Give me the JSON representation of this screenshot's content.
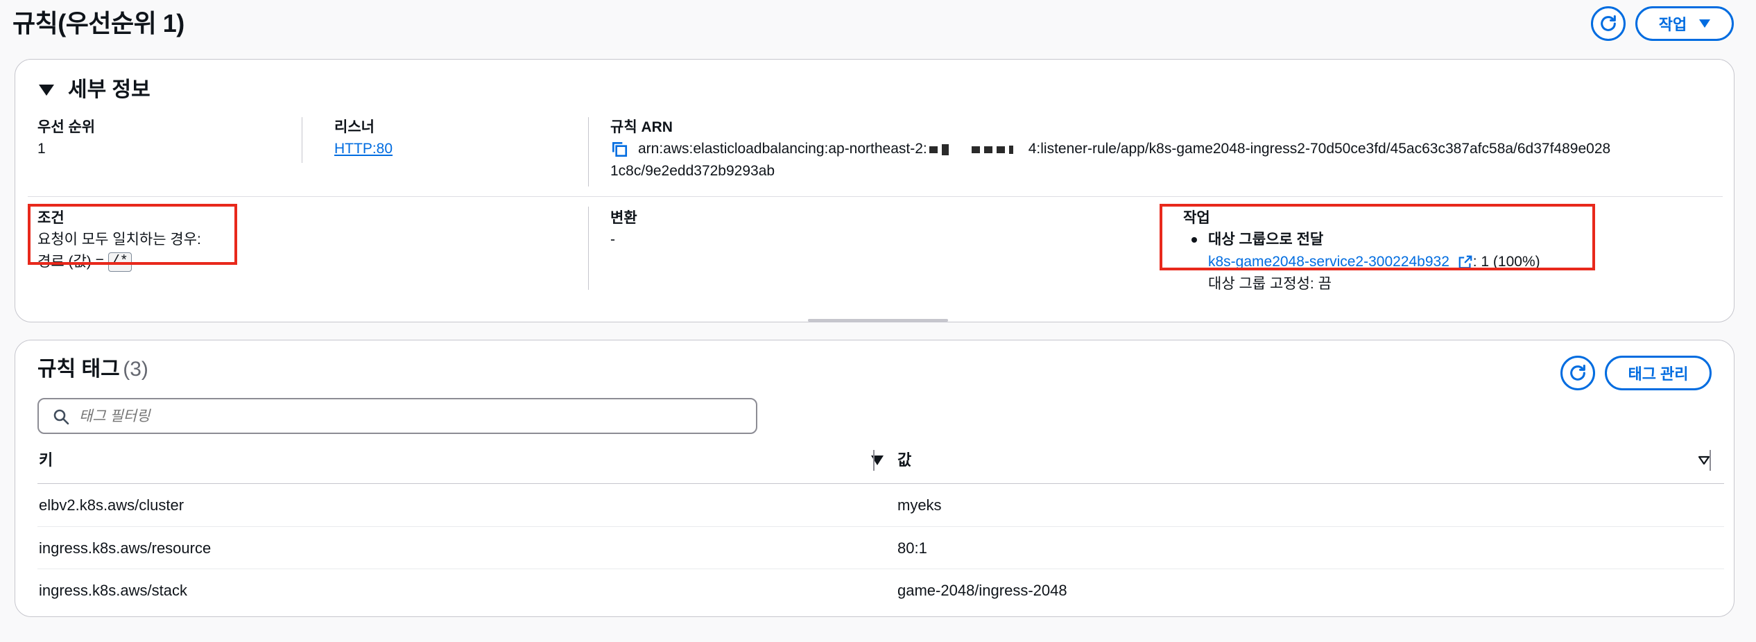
{
  "header": {
    "title": "규칙(우선순위 1)",
    "actions_label": "작업"
  },
  "details": {
    "section_title": "세부 정보",
    "priority": {
      "label": "우선 순위",
      "value": "1"
    },
    "listener": {
      "label": "리스너",
      "value": "HTTP:80"
    },
    "rule_arn": {
      "label": "규칙 ARN",
      "prefix": "arn:aws:elasticloadbalancing:ap-northeast-2:",
      "suffix": "4:listener-rule/app/k8s-game2048-ingress2-70d50ce3fd/45ac63c387afc58a/6d37f489e028",
      "line2": "1c8c/9e2edd372b9293ab"
    },
    "conditions": {
      "label": "조건",
      "line1": "요청이 모두 일치하는 경우:",
      "path_prefix": "경로 (값) =",
      "path_value": "/*"
    },
    "transform": {
      "label": "변환",
      "value": "-"
    },
    "action": {
      "label": "작업",
      "item_title": "대상 그룹으로 전달",
      "target_group": "k8s-game2048-service2-300224b932",
      "weight": ": 1 (100%)",
      "stickiness": "대상 그룹 고정성: 끔"
    }
  },
  "tags": {
    "title": "규칙 태그",
    "count": "(3)",
    "manage_label": "태그 관리",
    "filter_placeholder": "태그 필터링",
    "columns": {
      "key": "키",
      "value": "값"
    },
    "rows": [
      {
        "key": "elbv2.k8s.aws/cluster",
        "value": "myeks"
      },
      {
        "key": "ingress.k8s.aws/resource",
        "value": "80:1"
      },
      {
        "key": "ingress.k8s.aws/stack",
        "value": "game-2048/ingress-2048"
      }
    ]
  },
  "colors": {
    "primary": "#006ce0",
    "highlight": "#e8291c",
    "border": "#c6c6cd",
    "text": "#0f141a"
  }
}
